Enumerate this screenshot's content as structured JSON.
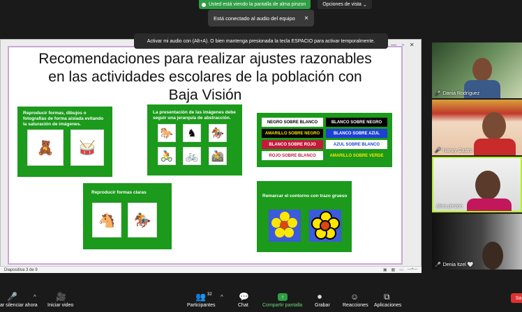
{
  "banner": {
    "sharing_text": "Usted está viendo la pantalla de alma pinzon",
    "view_options": "Opciones de vista"
  },
  "toast": {
    "audio_text": "Está conectado al audio del equipo",
    "close": "×"
  },
  "tooltip": {
    "mic_hint": "Activar mi audio con (Alt+A). O bien mantenga presionada la tecla ESPACIO para activar temporalmente."
  },
  "slide": {
    "title_line1": "Recomendaciones para realizar ajustes razonables",
    "title_line2": "en las actividades escolares de la población con",
    "title_line3": "Baja Visión",
    "card1": "Reproducir formas, dibujos o fotografías de forma aislada evitando la saturación de imágenes.",
    "card2": "La presentación de las imágenes debe seguir una jerarquía de abstracción.",
    "card3": "Reproducir formas claras",
    "card4": "Remarcar el contorno con trazo grueso",
    "contrast": [
      [
        "NEGRO SOBRE BLANCO",
        "BLANCO SOBRE NEGRO"
      ],
      [
        "AMARILLO SOBRE NEGRO",
        "BLANCO SOBRE AZUL"
      ],
      [
        "BLANCO SOBRE ROJO",
        "AZUL SOBRE BLANCO"
      ],
      [
        "ROJO SOBRE BLANCO",
        "AMARILLO SOBRE VERDE"
      ]
    ]
  },
  "statusbar": {
    "left": "Diapositiva 3 de 9"
  },
  "participants": [
    {
      "name": "Dania Rodríguez"
    },
    {
      "name": "Nancy Castro"
    },
    {
      "name": "alma pinzon"
    },
    {
      "name": "Denia Itzel 🤍"
    }
  ],
  "toolbar": {
    "mute": "ar silenciar ahora",
    "video": "Iniciar video",
    "participants": "Participantes",
    "participants_count": "32",
    "chat": "Chat",
    "share": "Compartir pantalla",
    "record": "Grabar",
    "reactions": "Reacciones",
    "apps": "Aplicaciones",
    "exit": "Sa"
  },
  "colors": {
    "slide_green": "#1b9a1b",
    "share_green": "#2f9e44",
    "toolbar_bg": "#1a1a1a"
  }
}
